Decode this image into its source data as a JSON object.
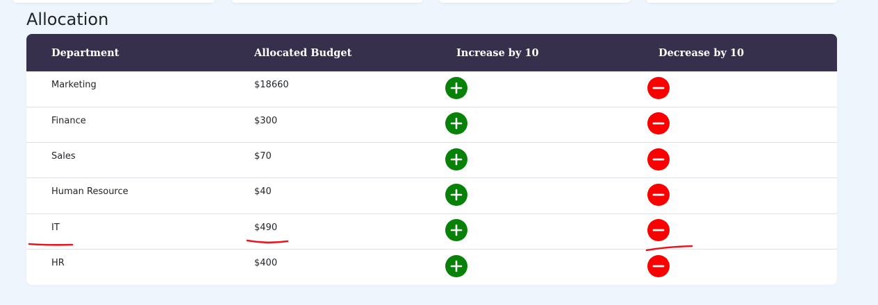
{
  "page": {
    "title": "Allocation"
  },
  "table": {
    "headers": {
      "department": "Department",
      "allocated_budget": "Allocated Budget",
      "increase": "Increase by 10",
      "decrease": "Decrease by 10"
    },
    "rows": [
      {
        "department": "Marketing",
        "budget": "$18660"
      },
      {
        "department": "Finance",
        "budget": "$300"
      },
      {
        "department": "Sales",
        "budget": "$70"
      },
      {
        "department": "Human Resource",
        "budget": "$40"
      },
      {
        "department": "IT",
        "budget": "$490"
      },
      {
        "department": "HR",
        "budget": "$400"
      }
    ],
    "increase_icon": "plus-circle-icon",
    "decrease_icon": "minus-circle-icon"
  },
  "colors": {
    "header_bg": "#37304c",
    "increase_button": "#078107",
    "decrease_button": "#fb0000",
    "annotation": "#e8141e",
    "page_bg": "#eff5fd"
  }
}
